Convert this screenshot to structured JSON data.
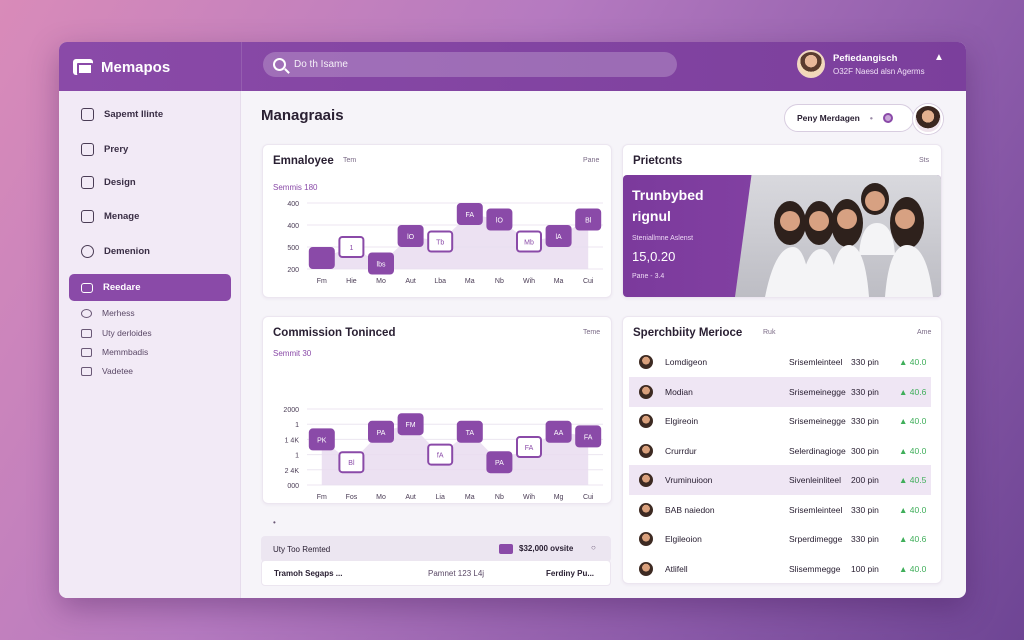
{
  "app": {
    "name": "Memapos"
  },
  "search": {
    "placeholder": "Do th Isame"
  },
  "user": {
    "name": "Pefiedangisch",
    "sub": "O32F Naesd alsn Agerms"
  },
  "sidebar": {
    "items": [
      {
        "label": "Sapemt Ilinte",
        "icon": "grid-icon"
      },
      {
        "label": "Prery",
        "icon": "clock-icon"
      },
      {
        "label": "Design",
        "icon": "pen-icon"
      },
      {
        "label": "Menage",
        "icon": "mail-icon"
      },
      {
        "label": "Demenion",
        "icon": "target-icon"
      }
    ],
    "active": {
      "label": "Reedare",
      "icon": "folder-icon"
    },
    "subitems": [
      {
        "label": "Merhess",
        "icon": "settings-icon"
      },
      {
        "label": "Uty derloides",
        "icon": "user-icon"
      },
      {
        "label": "Memmbadis",
        "icon": "list-icon"
      },
      {
        "label": "Vadetee",
        "icon": "toggle-icon"
      }
    ]
  },
  "main": {
    "title": "Managraais",
    "team_pill": "Peny Merdagen"
  },
  "employee_card": {
    "title": "Emnaloyee",
    "tag": "Tem",
    "menu": "Pane",
    "subtitle": "Semmis 180"
  },
  "commission_card": {
    "title": "Commission Toninced",
    "menu": "Teme",
    "subtitle": "Semmit 30"
  },
  "promo": {
    "header_title": "Prietcnts",
    "header_menu": "Sts",
    "title_line1": "Trunbybed",
    "title_line2": "rignul",
    "label": "Steniallmne Aslenst",
    "value": "15,0.20",
    "foot": "Pane - 3.4"
  },
  "specificity": {
    "title": "Sperchbiity Merioce",
    "tag": "Ruk",
    "menu": "Ame",
    "rows": [
      {
        "name": "Lomdigeon",
        "role": "Srisemleinteel",
        "hours": "330 pin",
        "delta": "▲ 40.0"
      },
      {
        "name": "Modian",
        "role": "Srisemeinegge",
        "hours": "330 pin",
        "delta": "▲ 40.6"
      },
      {
        "name": "Elgireoin",
        "role": "Srisemeinegge",
        "hours": "330 pin",
        "delta": "▲ 40.0"
      },
      {
        "name": "Crurrdur",
        "role": "Selerdinagioge",
        "hours": "300 pin",
        "delta": "▲ 40.0"
      },
      {
        "name": "Vruminuioon",
        "role": "Sivenleinliteel",
        "hours": "200 pin",
        "delta": "▲ 40.5"
      },
      {
        "name": "BAB naiedon",
        "role": "Srisemleinteel",
        "hours": "330 pin",
        "delta": "▲ 40.0"
      },
      {
        "name": "Elgileoion",
        "role": "Srperdimegge",
        "hours": "330 pin",
        "delta": "▲ 40.6"
      },
      {
        "name": "Atlifell",
        "role": "Slisemmegge",
        "hours": "100 pin",
        "delta": "▲ 40.0"
      }
    ]
  },
  "bottom": {
    "dot": "•",
    "row1_label": "Uty Too Remted",
    "row1_value": "$32,000 ovsite",
    "row2_col1": "Tramoh Segaps ...",
    "row2_col2": "Pamnet 123 L4j",
    "row2_col3": "Ferdiny Pu..."
  },
  "colors": {
    "accent": "#8a4aa8",
    "positive": "#3fae5a"
  },
  "chart_data": [
    {
      "type": "line",
      "title": "Emnaloyee",
      "categories": [
        "Fm",
        "Hie",
        "Mo",
        "Aut",
        "Lba",
        "Ma",
        "Nb",
        "Wih",
        "Ma",
        "Cui"
      ],
      "ytick_labels": [
        "400",
        "400",
        "500",
        "200"
      ],
      "values": [
        1,
        2,
        0.5,
        3,
        2.5,
        5,
        4.5,
        2.5,
        3,
        4.5
      ],
      "labels": [
        "",
        "1",
        "lbs",
        "lO",
        "Tb",
        "FA",
        "lO",
        "Mb",
        "lA",
        "Bl"
      ],
      "ylim": [
        0,
        6
      ]
    },
    {
      "type": "line",
      "title": "Commission Toninced",
      "categories": [
        "Fm",
        "Fos",
        "Mo",
        "Aut",
        "Lia",
        "Ma",
        "Nb",
        "Wih",
        "Mg",
        "Cui"
      ],
      "ytick_labels": [
        "2000",
        "1",
        "1 4K",
        "1",
        "2 4K",
        "000"
      ],
      "values": [
        3,
        1.5,
        3.5,
        4,
        2,
        3.5,
        1.5,
        2.5,
        3.5,
        3.2
      ],
      "labels": [
        "PK",
        "Bl",
        "PA",
        "FM",
        "fA",
        "TA",
        "PA",
        "FA",
        "AA",
        "FA"
      ],
      "ylim": [
        0,
        5
      ]
    }
  ]
}
